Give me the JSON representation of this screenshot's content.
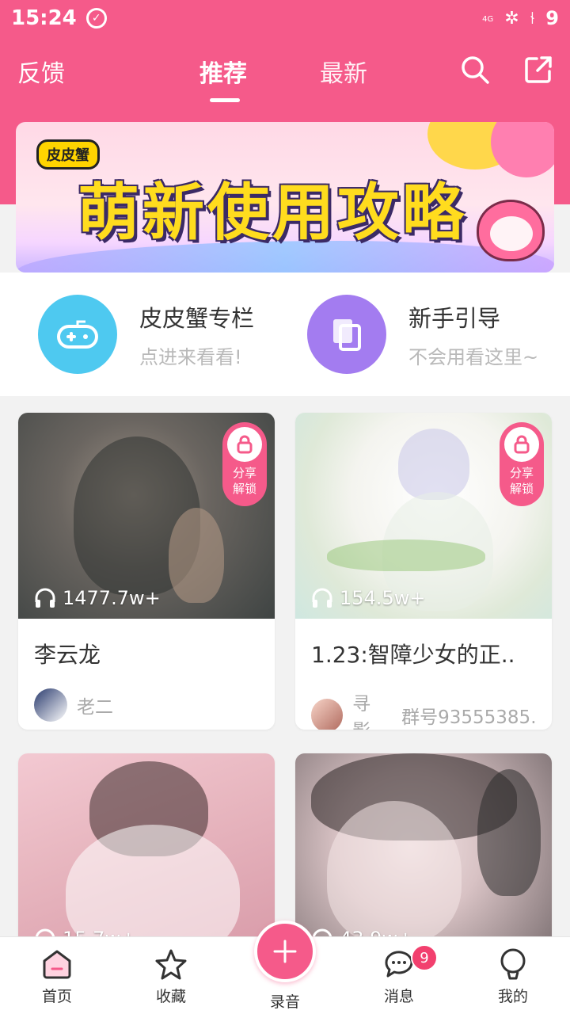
{
  "status_bar": {
    "time": "15:24",
    "network": "4G",
    "battery": "9"
  },
  "header": {
    "feedback_label": "反馈",
    "tabs": [
      {
        "label": "推荐",
        "active": true
      },
      {
        "label": "最新",
        "active": false
      }
    ],
    "icons": [
      "search-icon",
      "share-icon"
    ]
  },
  "banner": {
    "tag": "皮皮蟹",
    "title": "萌新使用攻略"
  },
  "entries": [
    {
      "name": "皮皮蟹专栏",
      "desc": "点进来看看!",
      "icon": "gamepad-icon",
      "color": "#4ec9f0"
    },
    {
      "name": "新手引导",
      "desc": "不会用看这里~",
      "icon": "book-icon",
      "color": "#a37cf0"
    }
  ],
  "cards": [
    {
      "title": "李云龙",
      "plays": "1477.7w+",
      "lock_text": "分享\n解锁",
      "author": "老二",
      "group": ""
    },
    {
      "title": "1.23:智障少女的正..",
      "plays": "154.5w+",
      "lock_text": "分享\n解锁",
      "author": "寻影",
      "group": "群号93555385.."
    },
    {
      "title": "",
      "plays": "15.7w+",
      "lock_text": "",
      "author": "",
      "group": ""
    },
    {
      "title": "",
      "plays": "43.9w+",
      "lock_text": "",
      "author": "",
      "group": ""
    }
  ],
  "bottom_nav": {
    "items": [
      {
        "label": "首页",
        "icon": "home-icon",
        "active": true
      },
      {
        "label": "收藏",
        "icon": "star-icon",
        "active": false
      },
      {
        "label": "录音",
        "icon": "plus-icon",
        "active": false
      },
      {
        "label": "消息",
        "icon": "message-icon",
        "active": false,
        "badge": "9"
      },
      {
        "label": "我的",
        "icon": "profile-icon",
        "active": false
      }
    ]
  },
  "colors": {
    "accent": "#f55a8a",
    "entry_blue": "#4ec9f0",
    "entry_purple": "#a37cf0"
  }
}
